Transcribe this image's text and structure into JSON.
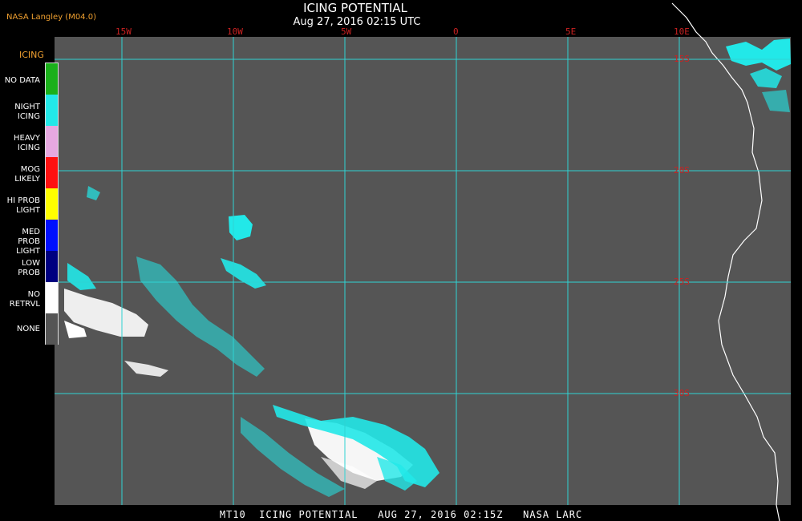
{
  "header": {
    "org": "NASA Langley (M04.0)",
    "title": "ICING POTENTIAL",
    "timestamp": "Aug 27, 2016 02:15 UTC"
  },
  "map": {
    "lon_labels": [
      "15W",
      "10W",
      "5W",
      "0",
      "5E",
      "10E"
    ],
    "lat_labels": [
      "15S",
      "20S",
      "25S",
      "30S"
    ],
    "grid_color": "#2ed3d3",
    "label_color": "#cc2222",
    "background_color": "#555555"
  },
  "legend": {
    "title": "ICING",
    "items": [
      {
        "label": "NO DATA",
        "color": "#1ab01a"
      },
      {
        "label": "NIGHT ICING",
        "color": "#22e8e8"
      },
      {
        "label": "HEAVY ICING",
        "color": "#e6a8e0"
      },
      {
        "label": "MOG LIKELY",
        "color": "#ff1010"
      },
      {
        "label": "HI PROB LIGHT",
        "color": "#ffff00"
      },
      {
        "label": "MED PROB LIGHT",
        "color": "#0010ff"
      },
      {
        "label": "LOW PROB",
        "color": "#000080"
      },
      {
        "label": "NO RETRVL",
        "color": "#ffffff"
      },
      {
        "label": "NONE",
        "color": "#555555"
      }
    ]
  },
  "footer": {
    "text": "MT10  ICING POTENTIAL   AUG 27, 2016 02:15Z   NASA LARC"
  }
}
